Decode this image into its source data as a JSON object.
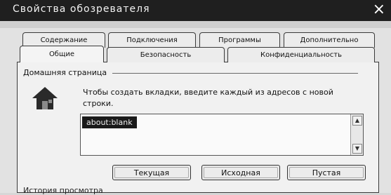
{
  "window": {
    "title": "Свойства обозревателя",
    "close_glyph": "×"
  },
  "tabs": {
    "row1": [
      {
        "label": "Содержание"
      },
      {
        "label": "Подключения"
      },
      {
        "label": "Программы"
      },
      {
        "label": "Дополнительно"
      }
    ],
    "row2": [
      {
        "label": "Общие",
        "active": true
      },
      {
        "label": "Безопасность"
      },
      {
        "label": "Конфиденциальность"
      }
    ]
  },
  "home_page": {
    "group_label": "Домашняя страница",
    "icon": "house-icon",
    "description": "Чтобы создать вкладки, введите каждый из адресов с новой строки.",
    "url_value": "about:blank",
    "buttons": {
      "current": "Текущая",
      "default": "Исходная",
      "blank": "Пустая"
    }
  },
  "next_section": {
    "label": "История просмотра"
  }
}
